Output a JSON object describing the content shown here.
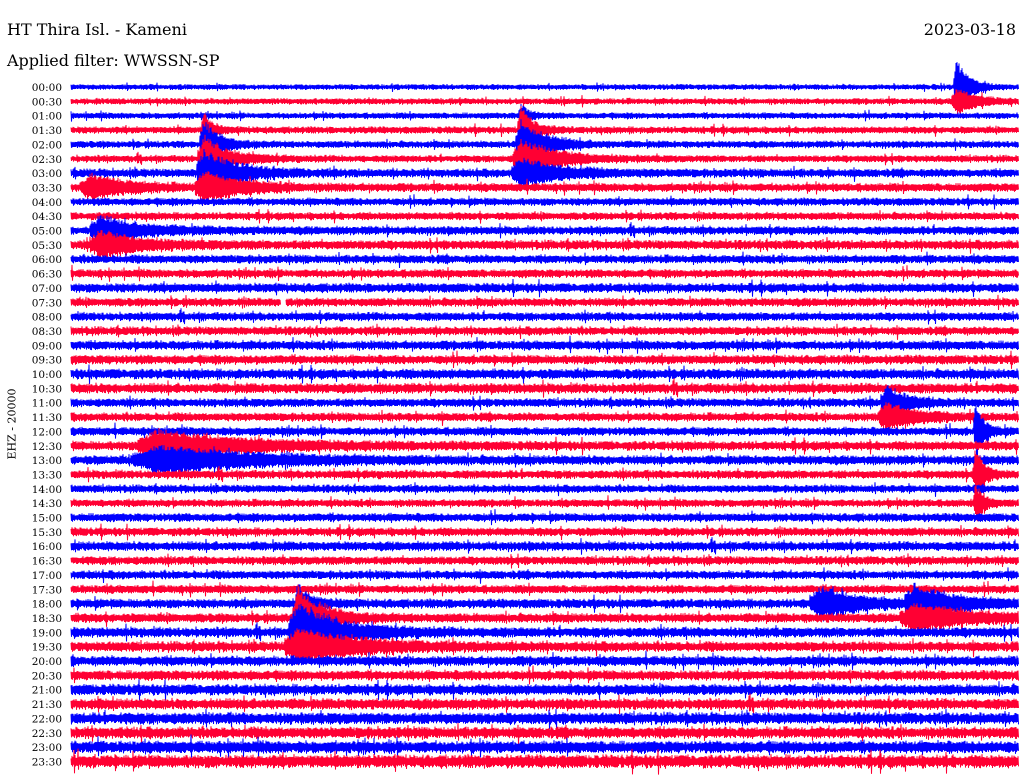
{
  "header": {
    "station": "HT Thira Isl. - Kameni",
    "date": "2023-03-18",
    "filter": "Applied filter: WWSSN-SP"
  },
  "chart_data": {
    "type": "line",
    "title": "HT Thira Isl. - Kameni",
    "ylabel": "EHZ - 20000",
    "row_labels": [
      "00:00",
      "00:30",
      "01:00",
      "01:30",
      "02:00",
      "02:30",
      "03:00",
      "03:30",
      "04:00",
      "04:30",
      "05:00",
      "05:30",
      "06:00",
      "06:30",
      "07:00",
      "07:30",
      "08:00",
      "08:30",
      "09:00",
      "09:30",
      "10:00",
      "10:30",
      "11:00",
      "11:30",
      "12:00",
      "12:30",
      "13:00",
      "13:30",
      "14:00",
      "14:30",
      "15:00",
      "15:30",
      "16:00",
      "16:30",
      "17:00",
      "17:30",
      "18:00",
      "18:30",
      "19:00",
      "19:30",
      "20:00",
      "20:30",
      "21:00",
      "21:30",
      "22:00",
      "22:30",
      "23:00",
      "23:30"
    ],
    "trace_colors": [
      "#0000ff",
      "#ff0033"
    ],
    "trace_pattern": "alternating rows: blue, red",
    "row_noise_level": [
      0.35,
      0.4,
      0.4,
      0.45,
      0.45,
      0.45,
      0.55,
      0.55,
      0.5,
      0.5,
      0.55,
      0.6,
      0.55,
      0.55,
      0.6,
      0.55,
      0.55,
      0.55,
      0.6,
      0.6,
      0.65,
      0.65,
      0.55,
      0.55,
      0.55,
      0.6,
      0.6,
      0.55,
      0.5,
      0.5,
      0.55,
      0.55,
      0.6,
      0.55,
      0.55,
      0.55,
      0.6,
      0.6,
      0.65,
      0.65,
      0.65,
      0.65,
      0.7,
      0.7,
      0.75,
      0.75,
      0.8,
      0.85
    ],
    "events": [
      {
        "row": 0,
        "x_frac": 0.935,
        "amp": 4.0,
        "width_frac": 0.006
      },
      {
        "row": 1,
        "x_frac": 0.935,
        "amp": 1.5,
        "width_frac": 0.01
      },
      {
        "row": 2,
        "x_frac": 0.475,
        "amp": 1.4,
        "width_frac": 0.004
      },
      {
        "row": 3,
        "x_frac": 0.14,
        "amp": 2.0,
        "width_frac": 0.004
      },
      {
        "row": 3,
        "x_frac": 0.475,
        "amp": 2.5,
        "width_frac": 0.006
      },
      {
        "row": 4,
        "x_frac": 0.14,
        "amp": 2.5,
        "width_frac": 0.008
      },
      {
        "row": 4,
        "x_frac": 0.475,
        "amp": 2.8,
        "width_frac": 0.012
      },
      {
        "row": 5,
        "x_frac": 0.14,
        "amp": 2.5,
        "width_frac": 0.012
      },
      {
        "row": 5,
        "x_frac": 0.475,
        "amp": 2.0,
        "width_frac": 0.018
      },
      {
        "row": 6,
        "x_frac": 0.14,
        "amp": 2.0,
        "width_frac": 0.016
      },
      {
        "row": 6,
        "x_frac": 0.475,
        "amp": 1.2,
        "width_frac": 0.02
      },
      {
        "row": 7,
        "x_frac": 0.14,
        "amp": 1.2,
        "width_frac": 0.02
      },
      {
        "row": 7,
        "x_frac": 0.02,
        "amp": 1.0,
        "width_frac": 0.02
      },
      {
        "row": 10,
        "x_frac": 0.03,
        "amp": 1.2,
        "width_frac": 0.02
      },
      {
        "row": 11,
        "x_frac": 0.03,
        "amp": 1.0,
        "width_frac": 0.02
      },
      {
        "row": 22,
        "x_frac": 0.86,
        "amp": 1.5,
        "width_frac": 0.01
      },
      {
        "row": 23,
        "x_frac": 0.86,
        "amp": 1.2,
        "width_frac": 0.015
      },
      {
        "row": 25,
        "x_frac": 0.09,
        "amp": 1.2,
        "width_frac": 0.04
      },
      {
        "row": 26,
        "x_frac": 0.09,
        "amp": 1.0,
        "width_frac": 0.05
      },
      {
        "row": 24,
        "x_frac": 0.955,
        "amp": 2.5,
        "width_frac": 0.004
      },
      {
        "row": 27,
        "x_frac": 0.955,
        "amp": 2.5,
        "width_frac": 0.004
      },
      {
        "row": 29,
        "x_frac": 0.955,
        "amp": 1.8,
        "width_frac": 0.004
      },
      {
        "row": 36,
        "x_frac": 0.24,
        "amp": 1.5,
        "width_frac": 0.006
      },
      {
        "row": 37,
        "x_frac": 0.24,
        "amp": 2.5,
        "width_frac": 0.012
      },
      {
        "row": 38,
        "x_frac": 0.24,
        "amp": 2.2,
        "width_frac": 0.02
      },
      {
        "row": 39,
        "x_frac": 0.24,
        "amp": 1.2,
        "width_frac": 0.03
      },
      {
        "row": 36,
        "x_frac": 0.89,
        "amp": 1.4,
        "width_frac": 0.02
      },
      {
        "row": 37,
        "x_frac": 0.89,
        "amp": 1.0,
        "width_frac": 0.03
      },
      {
        "row": 36,
        "x_frac": 0.79,
        "amp": 1.2,
        "width_frac": 0.02
      }
    ],
    "gaps": [
      {
        "row": 15,
        "x_frac": 0.224
      }
    ]
  }
}
